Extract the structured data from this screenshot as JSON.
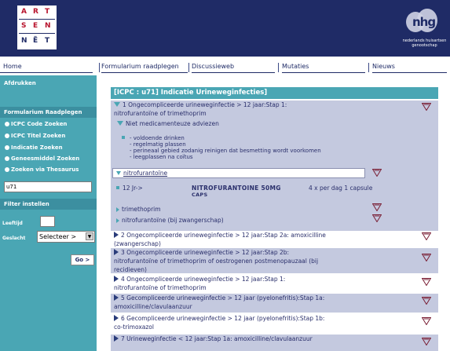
{
  "header": {
    "logo_letters": [
      "A",
      "R",
      "T",
      "S",
      "E",
      "N",
      "N",
      "Ë",
      "T"
    ],
    "nhg_mark": "nhg",
    "nhg_caption": "nederlands huisartsen genootschap"
  },
  "nav": {
    "items": [
      "Home",
      "Formularium raadplegen",
      "Discussieweb",
      "Mutaties",
      "Nieuws"
    ]
  },
  "sidebar": {
    "afdrukken": "Afdrukken",
    "formularium_header": "Formularium Raadplegen",
    "items": [
      "ICPC Code Zoeken",
      "ICPC Titel Zoeken",
      "Indicatie Zoeken",
      "Geneesmiddel Zoeken",
      "Zoeken via Thesaurus"
    ],
    "search_value": "u71",
    "filter_header": "Filter instellen",
    "leeftijd_label": "Leeftijd",
    "leeftijd_value": "",
    "geslacht_label": "Geslacht",
    "geslacht_value": "Selecteer >",
    "go_label": "Go >"
  },
  "main": {
    "title": "[ICPC : u71] Indicatie Urineweginfecties]",
    "row1": "1 Ongecompliceerde urineweginfectie > 12 jaar:Stap 1:",
    "row1b": "nitrofurantoïne of trimethoprim",
    "niet_med": "Niet medicamenteuze adviezen",
    "advice": [
      "voldoende drinken",
      "regelmatig plassen",
      "perineaal gebied zodanig reinigen dat besmetting wordt voorkomen",
      "leegplassen na coïtus"
    ],
    "nitro_box": "nitrofurantoïne",
    "dose_age": "12 Jr->",
    "dose_drug": "NITROFURANTOINE 50MG",
    "dose_form": "CAPS",
    "dose_freq": "4 x per dag 1 capsule",
    "trimethoprim": "trimethoprim",
    "nitro_preg": "nitrofurantoïne (bij zwangerschap)",
    "row2": "2 Ongecompliceerde urineweginfectie > 12 jaar:Stap 2a: amoxicilline",
    "row2b": "(zwangerschap)",
    "row3": "3 Ongecompliceerde urineweginfectie > 12 jaar:Stap 2b:",
    "row3b": "nitrofurantoïne of trimethoprim of oestrogenen postmenopauzaal (bij",
    "row3c": "recidieven)",
    "row4": "4 Ongecompliceerde urineweginfectie > 12 jaar:Stap 1:",
    "row4b": "nitrofurantoïne of trimethoprim",
    "row5": "5 Gecompliceerde urineweginfectie > 12 jaar (pyelonefritis):Stap 1a:",
    "row5b": "amoxicilline/clavulaanzuur",
    "row6": "6 Gecompliceerde urineweginfectie > 12 jaar (pyelonefritis):Stap 1b:",
    "row6b": "co-trimoxazol",
    "row7": "7 Urineweginfectie < 12 jaar:Stap 1a: amoxicilline/clavulaanzuur"
  },
  "colors": {
    "header_bg": "#1f2b66",
    "teal": "#4aa6b4",
    "shaded_row": "#c4c9df",
    "logo_red": "#b8142d"
  }
}
